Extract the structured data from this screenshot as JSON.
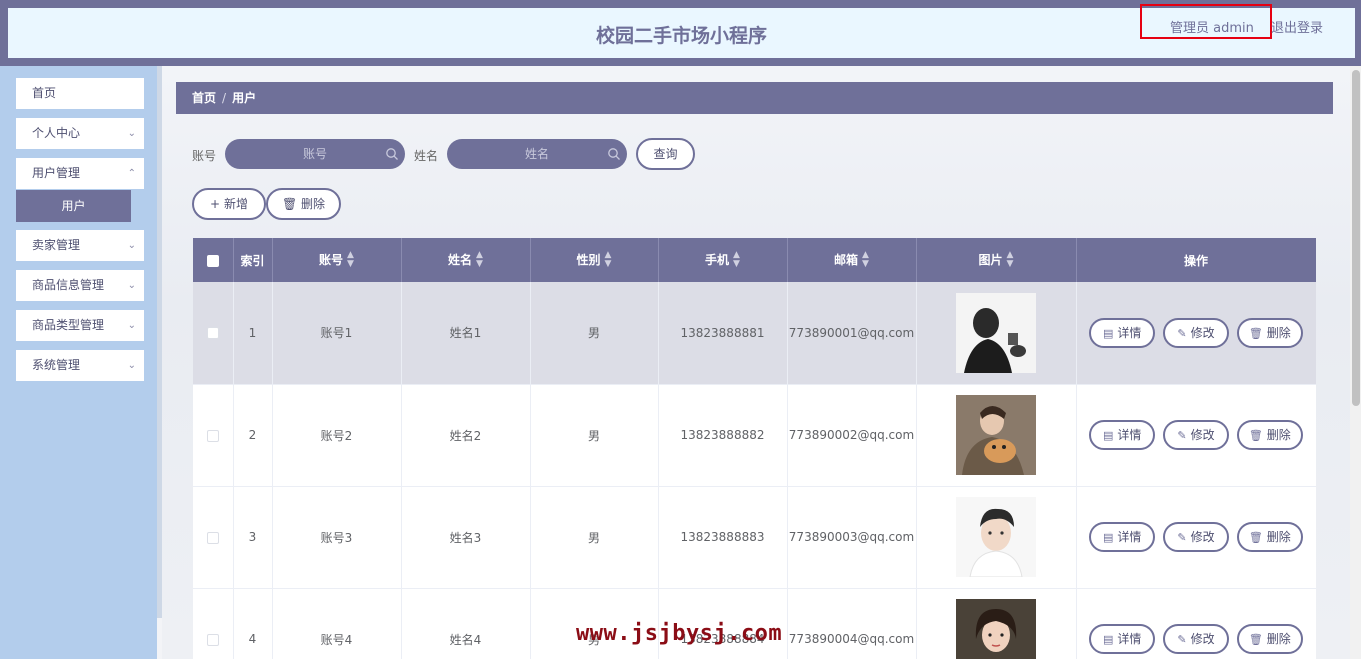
{
  "header": {
    "title": "校园二手市场小程序",
    "admin_label": "管理员 admin",
    "logout_label": "退出登录"
  },
  "sidebar": {
    "items": [
      {
        "label": "首页",
        "has_arrow": false
      },
      {
        "label": "个人中心",
        "has_arrow": true
      },
      {
        "label": "用户管理",
        "has_arrow": true
      },
      {
        "label": "卖家管理",
        "has_arrow": true
      },
      {
        "label": "商品信息管理",
        "has_arrow": true
      },
      {
        "label": "商品类型管理",
        "has_arrow": true
      },
      {
        "label": "系统管理",
        "has_arrow": true
      }
    ],
    "active_sub": "用户"
  },
  "breadcrumb": {
    "home": "首页",
    "sep": "/",
    "current": "用户"
  },
  "search": {
    "account_label": "账号",
    "account_placeholder": "账号",
    "name_label": "姓名",
    "name_placeholder": "姓名",
    "query_label": "查询"
  },
  "actions": {
    "add_label": "新增",
    "delete_label": "删除"
  },
  "table": {
    "headers": [
      "索引",
      "账号",
      "姓名",
      "性别",
      "手机",
      "邮箱",
      "图片",
      "操作"
    ],
    "rows": [
      {
        "index": "1",
        "account": "账号1",
        "name": "姓名1",
        "gender": "男",
        "phone": "13823888881",
        "email": "773890001@qq.com"
      },
      {
        "index": "2",
        "account": "账号2",
        "name": "姓名2",
        "gender": "男",
        "phone": "13823888882",
        "email": "773890002@qq.com"
      },
      {
        "index": "3",
        "account": "账号3",
        "name": "姓名3",
        "gender": "男",
        "phone": "13823888883",
        "email": "773890003@qq.com"
      },
      {
        "index": "4",
        "account": "账号4",
        "name": "姓名4",
        "gender": "男",
        "phone": "13823888884",
        "email": "773890004@qq.com"
      }
    ],
    "op_labels": {
      "detail": "详情",
      "edit": "修改",
      "delete": "删除"
    }
  },
  "watermark": "www.jsjbysj.com",
  "colors": {
    "primary": "#6f7099",
    "sidebar": "#b3cdec",
    "header_inner": "#eaf7ff",
    "highlight_box": "#e60012"
  }
}
